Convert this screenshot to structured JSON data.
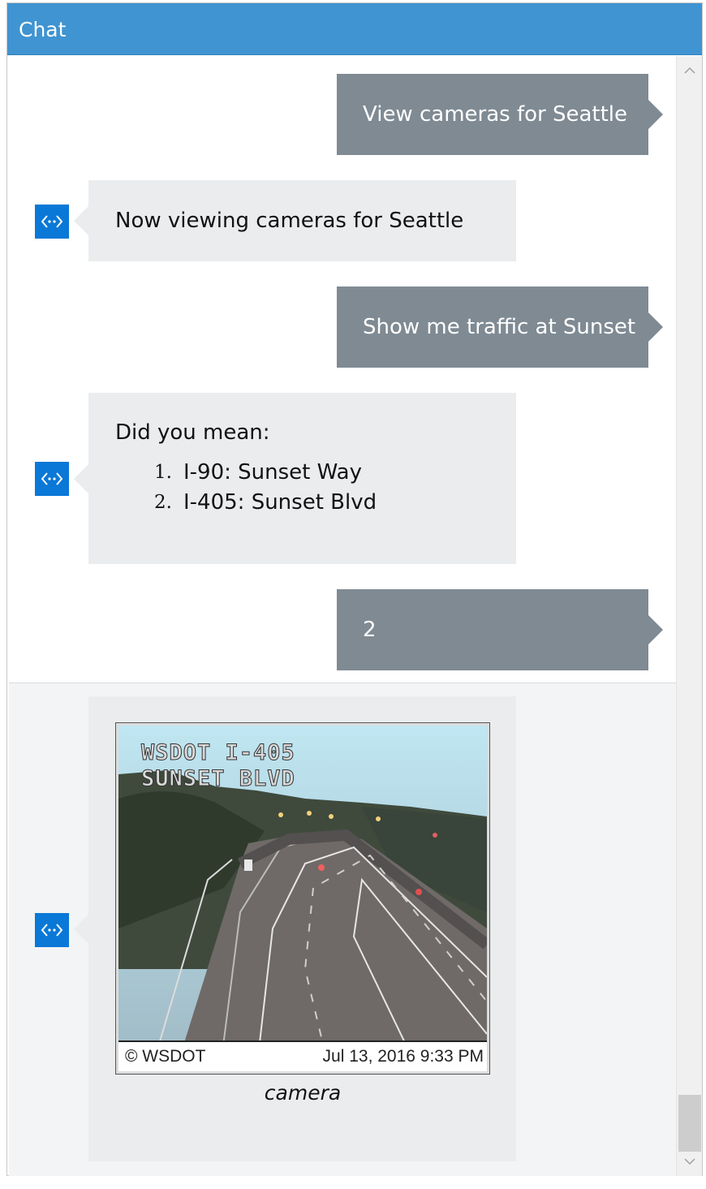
{
  "header": {
    "title": "Chat"
  },
  "messages": [
    {
      "from": "user",
      "text": "View cameras for Seattle"
    },
    {
      "from": "bot",
      "text": "Now viewing cameras for Seattle"
    },
    {
      "from": "user",
      "text": "Show me traffic at Sunset"
    },
    {
      "from": "bot",
      "intro": "Did you mean:",
      "options": [
        {
          "num": "1.",
          "label": "I-90: Sunset Way"
        },
        {
          "num": "2.",
          "label": "I-405: Sunset Blvd"
        }
      ]
    },
    {
      "from": "user",
      "text": "2"
    },
    {
      "from": "bot",
      "card": {
        "overlay_line1": "WSDOT  I-405",
        "overlay_line2": "SUNSET  BLVD",
        "footer_left": "© WSDOT",
        "footer_right": "Jul 13, 2016  9:33 PM",
        "caption": "camera"
      }
    }
  ],
  "icons": {
    "bot_avatar": "bot-avatar-icon",
    "scroll_up": "chevron-up-icon",
    "scroll_down": "chevron-down-icon"
  },
  "colors": {
    "header": "#3f94d1",
    "user_bubble": "#7f8a93",
    "bot_bubble": "#eaecee",
    "avatar": "#0a78d7"
  }
}
